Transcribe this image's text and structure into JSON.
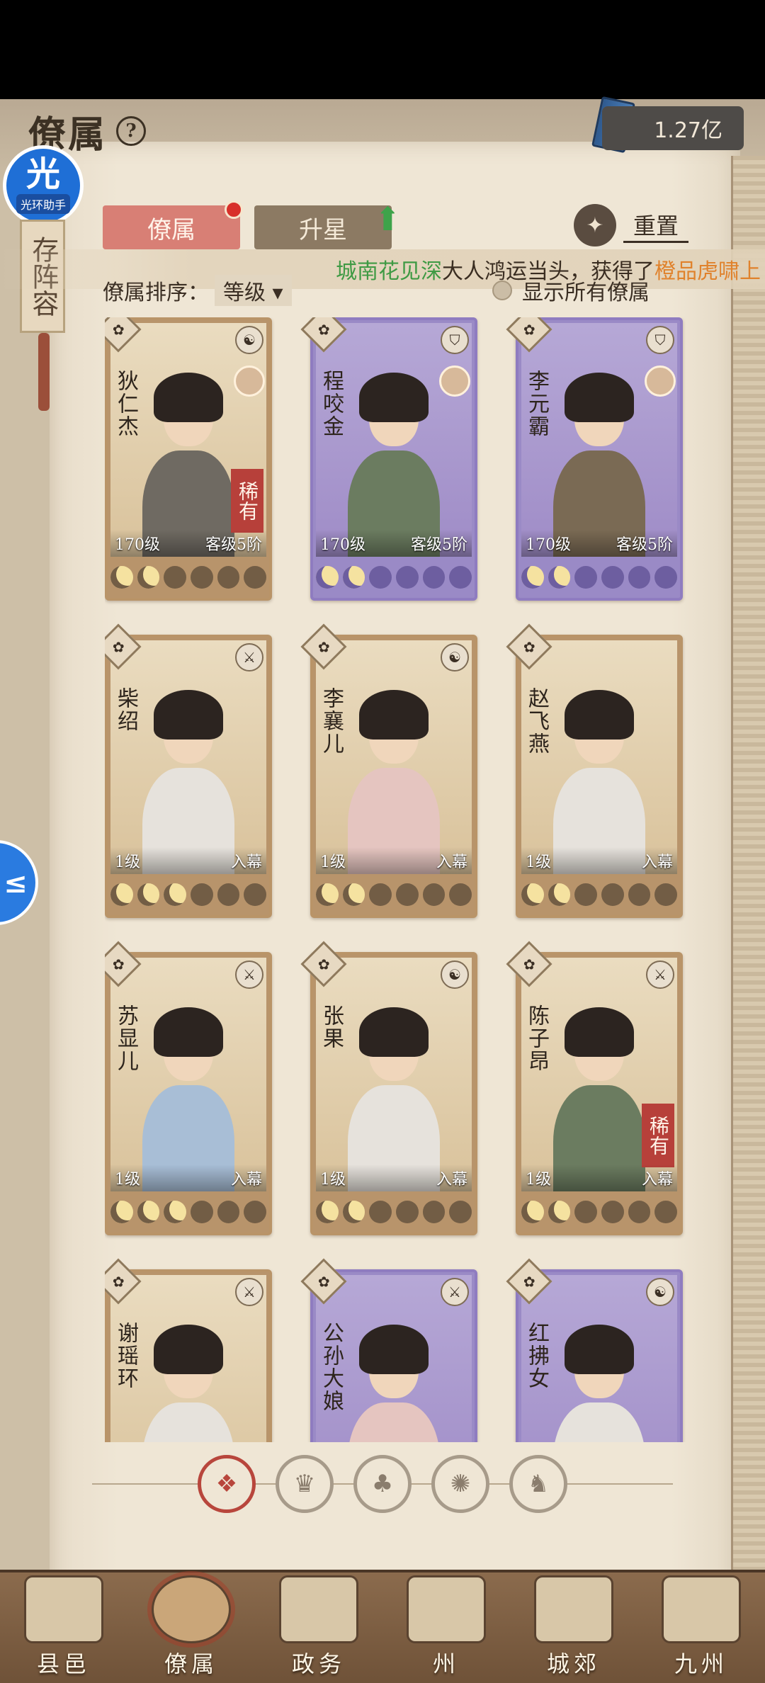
{
  "header": {
    "title": "僚属",
    "help_icon": "?",
    "currency_value": "1.27亿"
  },
  "helper_badge": {
    "main": "光",
    "sub": "光环助手"
  },
  "side_ribbon": {
    "text": "存阵容"
  },
  "tabs": [
    {
      "label": "僚属",
      "active": true
    },
    {
      "label": "升星",
      "active": false
    }
  ],
  "reset_label": "重置",
  "broadcast": {
    "player": "城南花见深",
    "middle": "大人鸿运当头，获得了",
    "item": "橙品虎啸上"
  },
  "sort": {
    "label": "僚属排序：",
    "value": "等级",
    "show_all_label": "显示所有僚属"
  },
  "cards": [
    {
      "name": "狄仁杰",
      "frame": "tan",
      "corner_icon": "yin-yang-icon",
      "rare_label": "稀有",
      "level": "170级",
      "rank": "客级5阶",
      "moons": 2,
      "has_avatar": true,
      "figure": ""
    },
    {
      "name": "程咬金",
      "frame": "purple",
      "corner_icon": "shield-icon",
      "rare_label": "",
      "level": "170级",
      "rank": "客级5阶",
      "moons": 2,
      "has_avatar": true,
      "figure": "green"
    },
    {
      "name": "李元霸",
      "frame": "purple",
      "corner_icon": "shield-icon",
      "rare_label": "",
      "level": "170级",
      "rank": "客级5阶",
      "moons": 2,
      "has_avatar": true,
      "figure": "purple"
    },
    {
      "name": "柴绍",
      "frame": "tan",
      "corner_icon": "sword-icon",
      "rare_label": "",
      "level": "1级",
      "rank": "入幕",
      "moons": 3,
      "has_avatar": false,
      "figure": "light"
    },
    {
      "name": "李襄儿",
      "frame": "tan",
      "corner_icon": "yin-yang-icon",
      "rare_label": "",
      "level": "1级",
      "rank": "入幕",
      "moons": 2,
      "has_avatar": false,
      "figure": "pink"
    },
    {
      "name": "赵飞燕",
      "frame": "tan",
      "corner_icon": "",
      "rare_label": "",
      "level": "1级",
      "rank": "入幕",
      "moons": 2,
      "has_avatar": false,
      "figure": "light"
    },
    {
      "name": "苏显儿",
      "frame": "tan",
      "corner_icon": "sword-icon",
      "rare_label": "",
      "level": "1级",
      "rank": "入幕",
      "moons": 3,
      "has_avatar": false,
      "figure": "blue"
    },
    {
      "name": "张果",
      "frame": "tan",
      "corner_icon": "yin-yang-icon",
      "rare_label": "",
      "level": "1级",
      "rank": "入幕",
      "moons": 2,
      "has_avatar": false,
      "figure": "light"
    },
    {
      "name": "陈子昂",
      "frame": "tan",
      "corner_icon": "sword-icon",
      "rare_label": "稀有",
      "level": "1级",
      "rank": "入幕",
      "moons": 2,
      "has_avatar": false,
      "figure": "green"
    },
    {
      "name": "谢瑶环",
      "frame": "tan",
      "corner_icon": "sword-icon",
      "rare_label": "",
      "level": "",
      "rank": "",
      "moons": 0,
      "has_avatar": false,
      "figure": "light"
    },
    {
      "name": "公孙大娘",
      "frame": "purple",
      "corner_icon": "sword-icon",
      "rare_label": "",
      "level": "",
      "rank": "",
      "moons": 0,
      "has_avatar": false,
      "figure": "pink"
    },
    {
      "name": "红拂女",
      "frame": "purple",
      "corner_icon": "yin-yang-icon",
      "rare_label": "",
      "level": "",
      "rank": "",
      "moons": 0,
      "has_avatar": false,
      "figure": "light"
    }
  ],
  "filters": [
    {
      "icon": "all-diamond-icon",
      "active": true
    },
    {
      "icon": "official-hat-icon",
      "active": false
    },
    {
      "icon": "gourd-icon",
      "active": false
    },
    {
      "icon": "fan-icon",
      "active": false
    },
    {
      "icon": "beast-icon",
      "active": false
    }
  ],
  "bottom_nav": [
    {
      "label": "县邑",
      "active": false
    },
    {
      "label": "僚属",
      "active": true
    },
    {
      "label": "政务",
      "active": false
    },
    {
      "label": "州",
      "active": false
    },
    {
      "label": "城郊",
      "active": false
    },
    {
      "label": "九州",
      "active": false
    }
  ],
  "floating_button": {
    "glyph": "≤"
  }
}
